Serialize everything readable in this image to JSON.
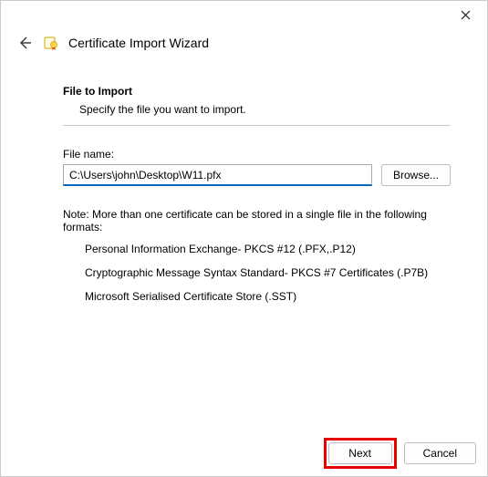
{
  "window": {
    "title": "Certificate Import Wizard"
  },
  "section": {
    "heading": "File to Import",
    "description": "Specify the file you want to import."
  },
  "file": {
    "label": "File name:",
    "value": "C:\\Users\\john\\Desktop\\W11.pfx",
    "browse": "Browse..."
  },
  "note": {
    "intro": "Note:  More than one certificate can be stored in a single file in the following formats:",
    "formats": [
      "Personal Information Exchange- PKCS #12 (.PFX,.P12)",
      "Cryptographic Message Syntax Standard- PKCS #7 Certificates (.P7B)",
      "Microsoft Serialised Certificate Store (.SST)"
    ]
  },
  "footer": {
    "next": "Next",
    "cancel": "Cancel"
  }
}
